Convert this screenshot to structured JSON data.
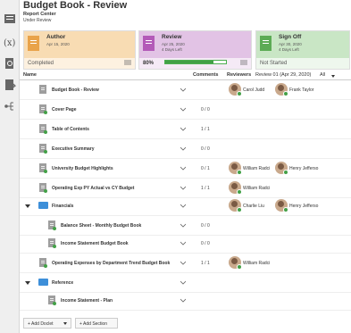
{
  "header": {
    "title": "Budget Book - Review",
    "subtitle": "Report Center",
    "status": "Under Review"
  },
  "cards": [
    {
      "name": "Author",
      "date": "Apr 15, 2020",
      "days": "",
      "status": "Completed",
      "band": "#f8dcb3",
      "bg": "#fdf1e0",
      "icon": "#e9a34a"
    },
    {
      "name": "Review",
      "date": "Apr 25, 2020",
      "days": "4 Days Left",
      "status": "80%",
      "progress": 0.8,
      "band": "#e2c3e5",
      "bg": "#f5eaf6",
      "icon": "#b35ab8"
    },
    {
      "name": "Sign Off",
      "date": "Apr 30, 2020",
      "days": "4 Days Left",
      "status": "Not Started",
      "band": "#c9e6c5",
      "bg": "#eef7ed",
      "icon": "#5cab55"
    }
  ],
  "columns": {
    "name": "Name",
    "comments": "Comments",
    "reviewers": "Reviewers",
    "review_round": "Review 01 (Apr 29, 2020)",
    "filter": "All"
  },
  "rows": [
    {
      "name": "Budget Book - Review",
      "comments": "",
      "reviewers": [
        "Carol Judd",
        "Frank Taylor"
      ],
      "type": "book"
    },
    {
      "name": "Cover Page",
      "comments": "0 / 0",
      "reviewers": [],
      "type": "doc"
    },
    {
      "name": "Table of Contents",
      "comments": "1 / 1",
      "reviewers": [],
      "type": "doc"
    },
    {
      "name": "Executive Summary",
      "comments": "0 / 0",
      "reviewers": [],
      "type": "doc"
    },
    {
      "name": "University Budget Highlights",
      "comments": "0 / 1",
      "reviewers": [
        "William Radci",
        "Henry Jefferso"
      ],
      "type": "doc"
    },
    {
      "name": "Operating Exp PY Actual vs CY Budget",
      "comments": "1 / 1",
      "reviewers": [
        "William Radci"
      ],
      "type": "doc"
    },
    {
      "name": "Financials",
      "comments": "",
      "reviewers": [
        "Charlie Liu",
        "Henry Jefferso"
      ],
      "type": "folder"
    },
    {
      "name": "Balance Sheet - Monthly Budget Book",
      "comments": "0 / 0",
      "reviewers": [],
      "type": "doc"
    },
    {
      "name": "Income Statement Budget Book",
      "comments": "0 / 0",
      "reviewers": [],
      "type": "doc"
    },
    {
      "name": "Operating Expenses by Department Trend Budget Book",
      "comments": "1 / 1",
      "reviewers": [
        "William Radci"
      ],
      "type": "doc"
    },
    {
      "name": "Reference",
      "comments": "",
      "reviewers": [],
      "type": "folder"
    },
    {
      "name": "Income Statement - Plan",
      "comments": "",
      "reviewers": [],
      "type": "doc"
    }
  ],
  "footer": {
    "add_doclet": "+ Add Doclet",
    "add_section": "+ Add Section"
  },
  "sidebar_icons": [
    "library-icon",
    "variable-icon",
    "search-doc-icon",
    "doc-export-icon",
    "hierarchy-icon"
  ]
}
